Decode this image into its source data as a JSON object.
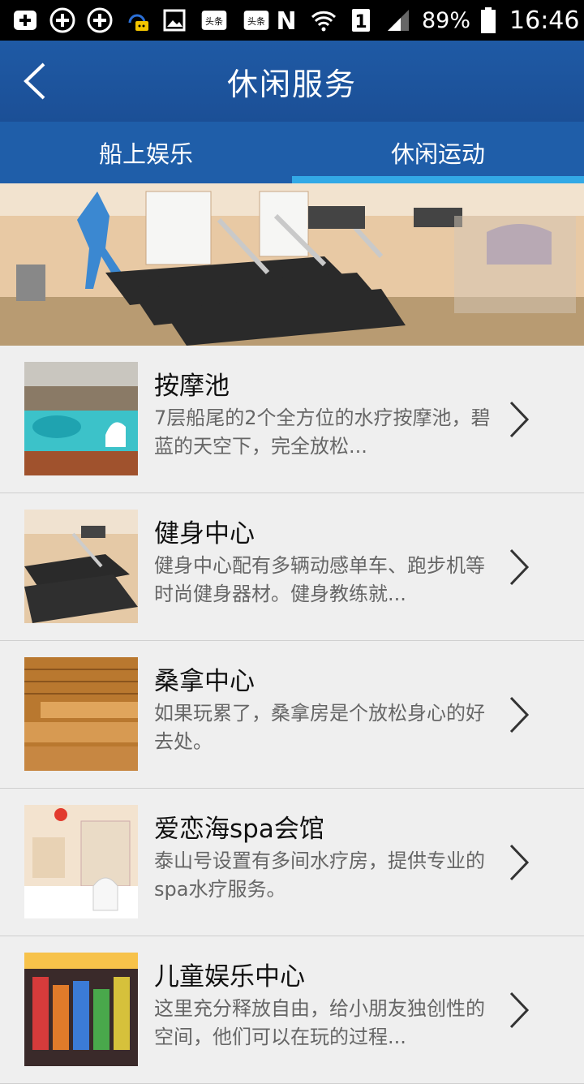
{
  "status_bar": {
    "battery": "89%",
    "time": "16:46",
    "sim_badge": "1",
    "news1": "头条",
    "news2": "头条"
  },
  "header": {
    "title": "休闲服务"
  },
  "tabs": [
    {
      "label": "船上娱乐",
      "active": false
    },
    {
      "label": "休闲运动",
      "active": true
    }
  ],
  "items": [
    {
      "title": "按摩池",
      "desc": "7层船尾的2个全方位的水疗按摩池，碧蓝的天空下，完全放松..."
    },
    {
      "title": "健身中心",
      "desc": "健身中心配有多辆动感单车、跑步机等时尚健身器材。健身教练就..."
    },
    {
      "title": "桑拿中心",
      "desc": " 如果玩累了，桑拿房是个放松身心的好去处。"
    },
    {
      "title": "爱恋海spa会馆",
      "desc": "泰山号设置有多间水疗房，提供专业的spa水疗服务。"
    },
    {
      "title": "儿童娱乐中心",
      "desc": "这里充分释放自由，给小朋友独创性的空间，他们可以在玩的过程..."
    }
  ]
}
